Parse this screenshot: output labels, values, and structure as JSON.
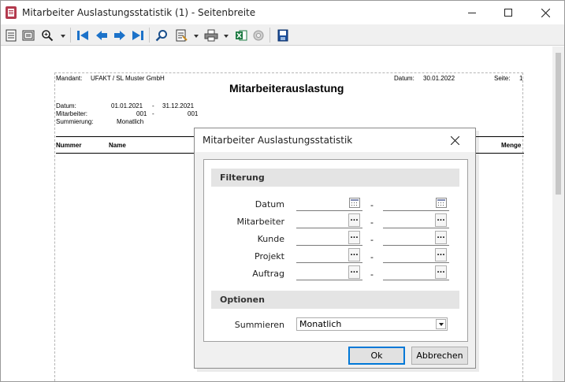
{
  "window": {
    "title": "Mitarbeiter Auslastungsstatistik (1) - Seitenbreite"
  },
  "toolbar": {
    "icons": [
      "page-view-icon",
      "page-width-icon",
      "zoom-icon",
      "first-page-icon",
      "prev-page-icon",
      "next-page-icon",
      "last-page-icon",
      "search-icon",
      "export-icon",
      "print-icon",
      "excel-icon",
      "settings-icon",
      "save-icon"
    ],
    "colors": {
      "nav_blue": "#1c72c9",
      "excel_green": "#1e7b43"
    }
  },
  "report": {
    "mandant_label": "Mandant:",
    "mandant_value": "UFAKT  /  SL Muster GmbH",
    "datum_label": "Datum:",
    "datum_value": "30.01.2022",
    "seite_label": "Seite:",
    "seite_value": "1",
    "title": "Mitarbeiterauslastung",
    "filter_datum_label": "Datum:",
    "filter_datum_from": "01.01.2021",
    "filter_datum_to": "31.12.2021",
    "filter_ma_label": "Mitarbeiter:",
    "filter_ma_from": "001",
    "filter_ma_to": "001",
    "filter_sum_label": "Summierung:",
    "filter_sum_value": "Monatlich",
    "dash": "-",
    "col_nummer": "Nummer",
    "col_name": "Name",
    "col_menge": "Menge"
  },
  "dialog": {
    "title": "Mitarbeiter Auslastungsstatistik",
    "section_filter": "Filterung",
    "section_options": "Optionen",
    "rows": [
      {
        "label": "Datum",
        "from": "",
        "to": ""
      },
      {
        "label": "Mitarbeiter",
        "from": "",
        "to": ""
      },
      {
        "label": "Kunde",
        "from": "",
        "to": ""
      },
      {
        "label": "Projekt",
        "from": "",
        "to": ""
      },
      {
        "label": "Auftrag",
        "from": "",
        "to": ""
      }
    ],
    "range_separator": "-",
    "browse_label": "...",
    "summieren_label": "Summieren",
    "summieren_value": "Monatlich",
    "ok_label": "Ok",
    "cancel_label": "Abbrechen"
  }
}
